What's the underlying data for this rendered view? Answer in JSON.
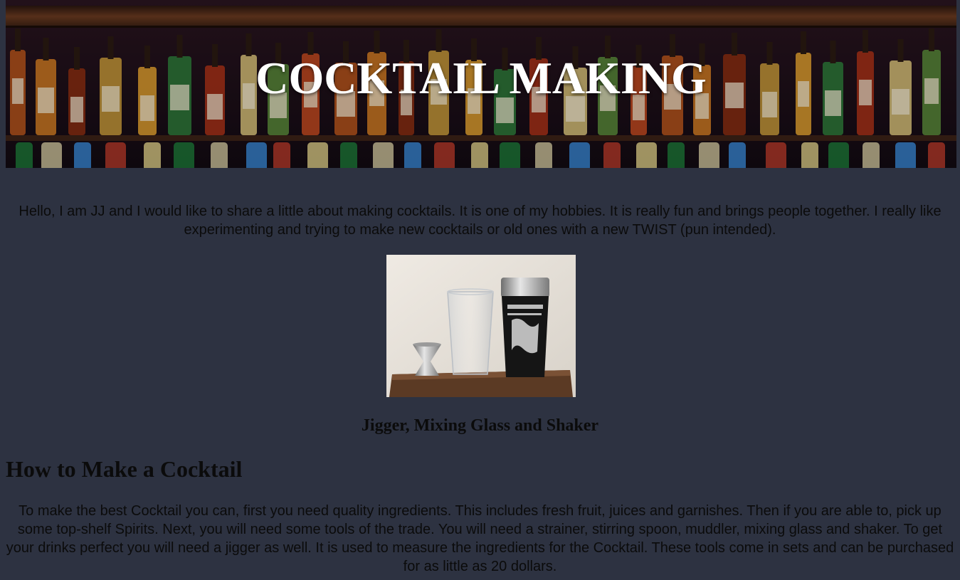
{
  "hero": {
    "title": "COCKTAIL MAKING",
    "image": "bar-shelf-liquor-bottles"
  },
  "intro": {
    "text": "Hello, I am JJ and I would like to share a little about making cocktails.  It is one of my hobbies.  It is really fun and brings people together.  I really like experimenting and trying to make new cocktails or old ones with a new TWIST (pun intended)."
  },
  "figure": {
    "image": "jigger-mixing-glass-shaker-photo",
    "caption": "Jigger, Mixing Glass and Shaker"
  },
  "section": {
    "heading": "How to Make a Cocktail",
    "text": "To make the best Cocktail you can, first you need quality ingredients.  This includes fresh fruit, juices and garnishes.  Then if you are able to, pick up some top-shelf Spirits. Next, you will need some tools of the trade. You will need a strainer, stirring spoon, muddler, mixing glass and shaker.  To get your drinks perfect you will need a jigger as well.  It is used to measure the ingredients for the Cocktail. These tools come in sets and can be purchased for as little as 20 dollars."
  },
  "colors": {
    "page_background": "#2d3241",
    "text": "#0b0b0b",
    "hero_title": "#ffffff"
  }
}
